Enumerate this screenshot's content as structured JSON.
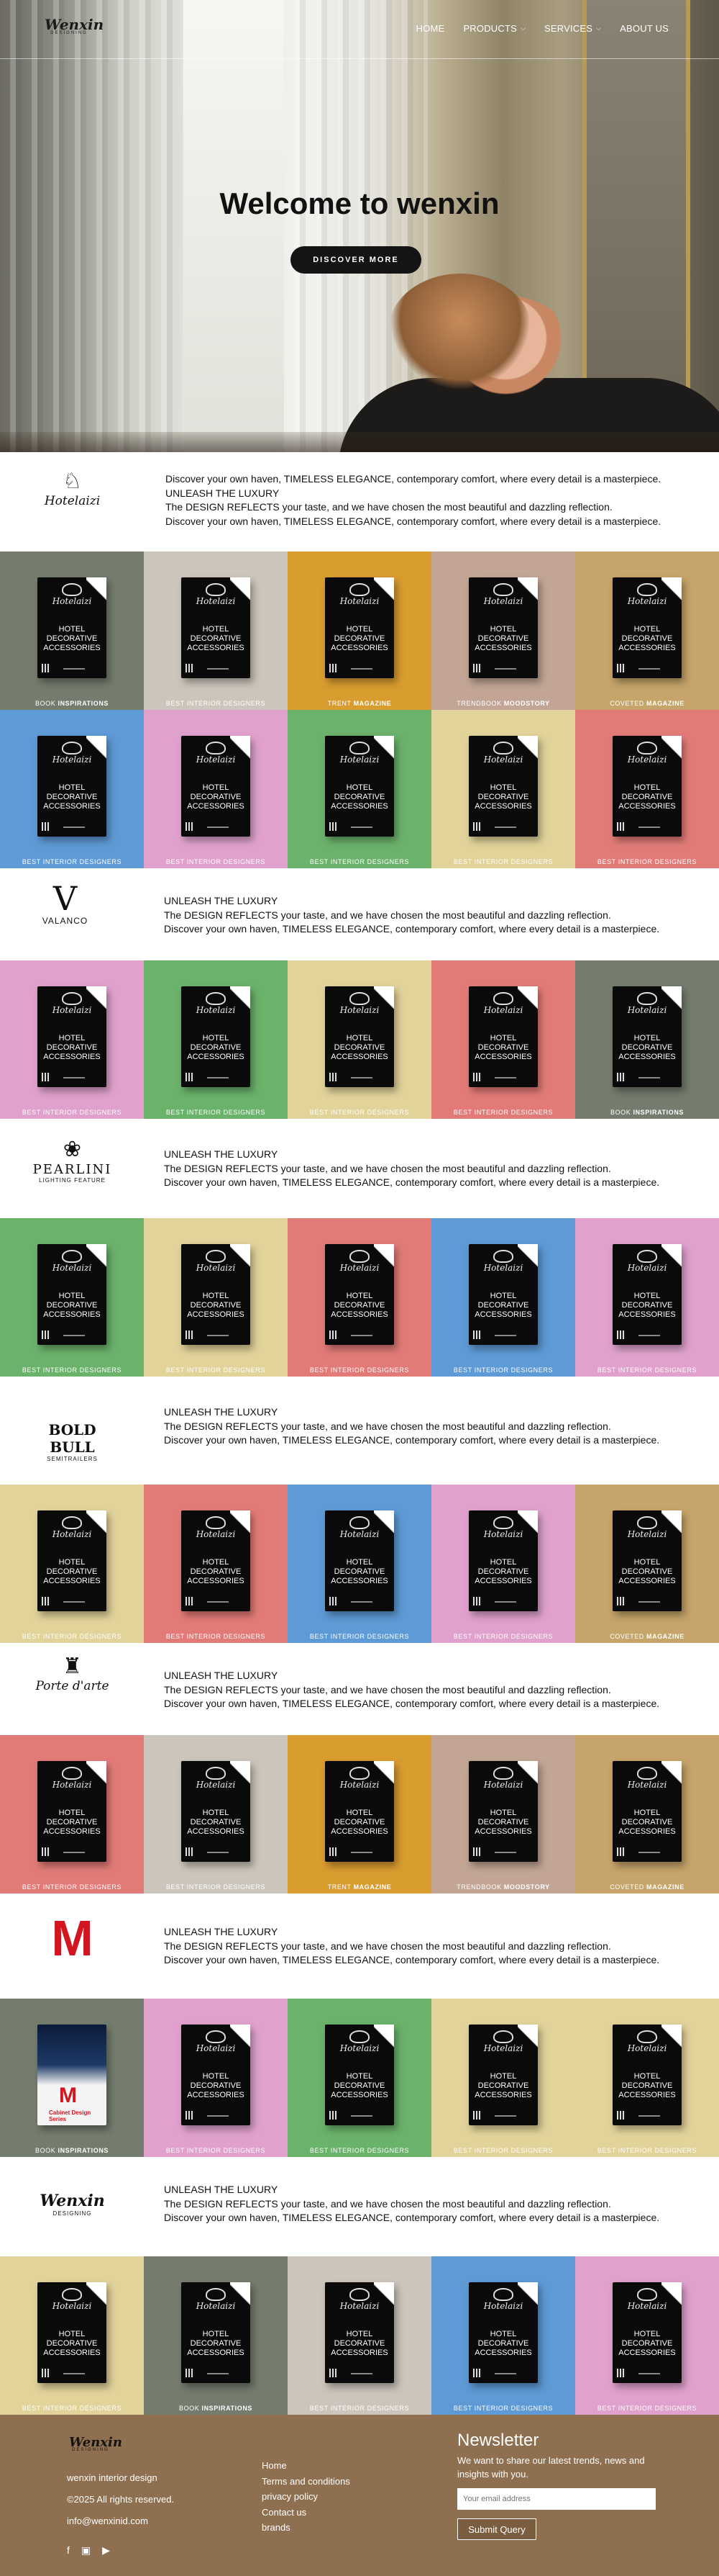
{
  "nav": {
    "logo_text": "Wenxin",
    "logo_sub": "DESIGNING",
    "items": [
      {
        "label": "HOME",
        "dropdown": false
      },
      {
        "label": "PRODUCTS",
        "dropdown": true
      },
      {
        "label": "SERVICES",
        "dropdown": true
      },
      {
        "label": "ABOUT US",
        "dropdown": false
      }
    ]
  },
  "hero": {
    "title": "Welcome to wenxin",
    "cta": "DISCOVER MORE"
  },
  "brands": [
    {
      "logo": "Hotelaizi",
      "lines": [
        "Discover your own haven, TIMELESS ELEGANCE, contemporary comfort, where every detail is a masterpiece.",
        "UNLEASH THE LUXURY",
        "The DESIGN REFLECTS your taste, and we have chosen the most beautiful and dazzling reflection.",
        "Discover your own haven, TIMELESS ELEGANCE, contemporary comfort, where every detail is a masterpiece."
      ]
    },
    {
      "logo": "VALANCO",
      "lines": [
        "UNLEASH THE LUXURY",
        "The DESIGN REFLECTS your taste, and we have chosen the most beautiful and dazzling reflection.",
        "Discover your own haven, TIMELESS ELEGANCE, contemporary comfort, where every detail is a masterpiece."
      ]
    },
    {
      "logo": "PEARLINI",
      "logo_sub": "LIGHTING FEATURE",
      "lines": [
        "UNLEASH THE LUXURY",
        "The DESIGN REFLECTS your taste, and we have chosen the most beautiful and dazzling reflection.",
        "Discover your own haven, TIMELESS ELEGANCE, contemporary comfort, where every detail is a masterpiece."
      ]
    },
    {
      "logo": "BOLD BULL",
      "logo_sub": "SEMITRAILERS",
      "lines": [
        "UNLEASH THE LUXURY",
        "The DESIGN REFLECTS your taste, and we have chosen the most beautiful and dazzling reflection.",
        "Discover your own haven, TIMELESS ELEGANCE, contemporary comfort, where every detail is a masterpiece."
      ]
    },
    {
      "logo": "Porte d'arte",
      "lines": [
        "UNLEASH THE LUXURY",
        "The DESIGN REFLECTS your taste, and we have chosen the most beautiful and dazzling reflection.",
        "Discover your own haven, TIMELESS ELEGANCE, contemporary comfort, where every detail is a masterpiece."
      ]
    },
    {
      "logo": "M",
      "lines": [
        "UNLEASH THE LUXURY",
        "The DESIGN REFLECTS your taste, and we have chosen the most beautiful and dazzling reflection.",
        "Discover your own haven, TIMELESS ELEGANCE, contemporary comfort, where every detail is a masterpiece."
      ]
    },
    {
      "logo": "Wenxin",
      "logo_sub": "DESIGNING",
      "lines": [
        "UNLEASH THE LUXURY",
        "The DESIGN REFLECTS your taste, and we have chosen the most beautiful and dazzling reflection.",
        "Discover your own haven, TIMELESS ELEGANCE, contemporary comfort, where every detail is a masterpiece."
      ]
    }
  ],
  "book": {
    "script": "Hotelaizi",
    "title": [
      "HOTEL",
      "DECORATIVE",
      "ACCESSORIES"
    ]
  },
  "grids": [
    [
      {
        "bg": "#737c6d",
        "cap": "BOOK ",
        "capb": "INSPIRATIONS"
      },
      {
        "bg": "#ccc5bb",
        "cap": "BEST INTERIOR DESIGNERS",
        "capb": ""
      },
      {
        "bg": "#d99c2f",
        "cap": "TRENT ",
        "capb": "MAGAZINE"
      },
      {
        "bg": "#c2a595",
        "cap": "TRENDBOOK ",
        "capb": "MOODSTORY"
      },
      {
        "bg": "#c6a46a",
        "cap": "COVETED ",
        "capb": "MAGAZINE"
      },
      {
        "bg": "#5e9ad6",
        "cap": "BEST INTERIOR DESIGNERS",
        "capb": ""
      },
      {
        "bg": "#e0a2cc",
        "cap": "BEST INTERIOR DESIGNERS",
        "capb": ""
      },
      {
        "bg": "#6bb26b",
        "cap": "BEST INTERIOR DESIGNERS",
        "capb": ""
      },
      {
        "bg": "#e1d39a",
        "cap": "BEST INTERIOR DESIGNERS",
        "capb": ""
      },
      {
        "bg": "#e27b78",
        "cap": "BEST INTERIOR DESIGNERS",
        "capb": ""
      }
    ],
    [
      {
        "bg": "#e0a2cc",
        "cap": "BEST INTERIOR DESIGNERS",
        "capb": ""
      },
      {
        "bg": "#6bb26b",
        "cap": "BEST INTERIOR DESIGNERS",
        "capb": ""
      },
      {
        "bg": "#e1d39a",
        "cap": "BEST INTERIOR DESIGNERS",
        "capb": ""
      },
      {
        "bg": "#e27b78",
        "cap": "BEST INTERIOR DESIGNERS",
        "capb": ""
      },
      {
        "bg": "#737c6d",
        "cap": "BOOK ",
        "capb": "INSPIRATIONS"
      }
    ],
    [
      {
        "bg": "#6bb26b",
        "cap": "BEST INTERIOR DESIGNERS",
        "capb": ""
      },
      {
        "bg": "#e1d39a",
        "cap": "BEST INTERIOR DESIGNERS",
        "capb": ""
      },
      {
        "bg": "#e27b78",
        "cap": "BEST INTERIOR DESIGNERS",
        "capb": ""
      },
      {
        "bg": "#5e9ad6",
        "cap": "BEST INTERIOR DESIGNERS",
        "capb": ""
      },
      {
        "bg": "#e0a2cc",
        "cap": "BEST INTERIOR DESIGNERS",
        "capb": ""
      }
    ],
    [
      {
        "bg": "#e1d39a",
        "cap": "BEST INTERIOR DESIGNERS",
        "capb": ""
      },
      {
        "bg": "#e27b78",
        "cap": "BEST INTERIOR DESIGNERS",
        "capb": ""
      },
      {
        "bg": "#5e9ad6",
        "cap": "BEST INTERIOR DESIGNERS",
        "capb": ""
      },
      {
        "bg": "#e0a2cc",
        "cap": "BEST INTERIOR DESIGNERS",
        "capb": ""
      },
      {
        "bg": "#c6a46a",
        "cap": "COVETED ",
        "capb": "MAGAZINE"
      }
    ],
    [
      {
        "bg": "#e27b78",
        "cap": "BEST INTERIOR DESIGNERS",
        "capb": ""
      },
      {
        "bg": "#ccc5bb",
        "cap": "BEST INTERIOR DESIGNERS",
        "capb": ""
      },
      {
        "bg": "#d99c2f",
        "cap": "TRENT ",
        "capb": "MAGAZINE"
      },
      {
        "bg": "#c2a595",
        "cap": "TRENDBOOK ",
        "capb": "MOODSTORY"
      },
      {
        "bg": "#c6a46a",
        "cap": "COVETED ",
        "capb": "MAGAZINE"
      }
    ],
    [
      {
        "bg": "#737c6d",
        "cap": "BOOK ",
        "capb": "INSPIRATIONS",
        "feature": true
      },
      {
        "bg": "#e0a2cc",
        "cap": "BEST INTERIOR DESIGNERS",
        "capb": ""
      },
      {
        "bg": "#6bb26b",
        "cap": "BEST INTERIOR DESIGNERS",
        "capb": ""
      },
      {
        "bg": "#e1d39a",
        "cap": "BEST INTERIOR DESIGNERS",
        "capb": ""
      },
      {
        "bg": "#e1d39a",
        "cap": "BEST INTERIOR DESIGNERS",
        "capb": ""
      }
    ],
    [
      {
        "bg": "#e1d39a",
        "cap": "BEST INTERIOR DESIGNERS",
        "capb": ""
      },
      {
        "bg": "#737c6d",
        "cap": "BOOK ",
        "capb": "INSPIRATIONS"
      },
      {
        "bg": "#ccc5bb",
        "cap": "BEST INTERIOR DESIGNERS",
        "capb": ""
      },
      {
        "bg": "#5e9ad6",
        "cap": "BEST INTERIOR DESIGNERS",
        "capb": ""
      },
      {
        "bg": "#e0a2cc",
        "cap": "BEST INTERIOR DESIGNERS",
        "capb": ""
      }
    ]
  ],
  "feature_book": {
    "letter": "M",
    "label": "Cabinet Design Series"
  },
  "footer": {
    "logo_text": "Wenxin",
    "logo_sub": "DESIGNING",
    "company": "wenxin interior design",
    "copyright": "©2025 All rights reserved.",
    "email": "info@wenxinid.com",
    "links": [
      "Home",
      "Terms and conditions",
      "privacy policy",
      "Contact us",
      "brands"
    ],
    "newsletter_title": "Newsletter",
    "newsletter_text": "We want to share our latest trends, news and insights with you.",
    "email_placeholder": "Your email address",
    "submit": "Submit Query",
    "social": [
      "facebook-icon",
      "instagram-icon",
      "youtube-icon"
    ]
  }
}
